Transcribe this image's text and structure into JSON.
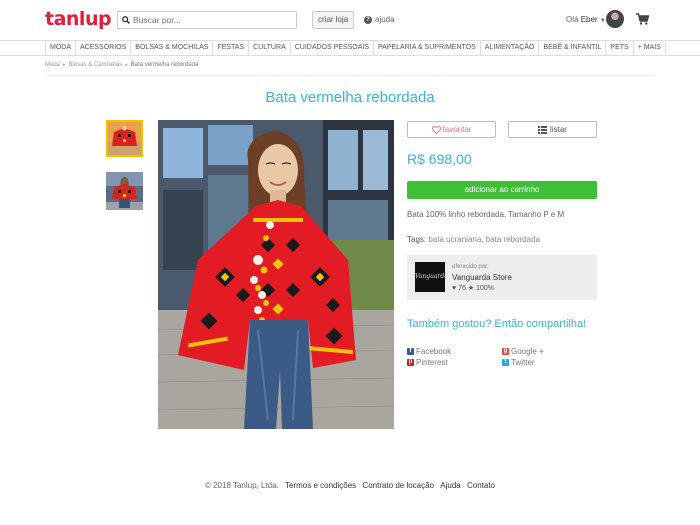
{
  "header": {
    "logo": "tanlup",
    "search_placeholder": "Buscar por...",
    "create_store": "criar loja",
    "help": "ajuda",
    "greeting": "Olá",
    "user_name": "Eber",
    "icons": {
      "search": "search-icon",
      "help": "question-icon",
      "cart": "cart-icon"
    }
  },
  "categories": [
    "MODA",
    "ACESSÓRIOS",
    "BOLSAS & MOCHILAS",
    "FESTAS",
    "CULTURA",
    "CUIDADOS PESSOAIS",
    "PAPELARIA & SUPRIMENTOS",
    "ALIMENTAÇÃO",
    "BEBÊ & INFANTIL",
    "PETS",
    "+ MAIS"
  ],
  "breadcrumbs": [
    "Moda",
    "Blusas & Camisetas",
    "Bata vermelha rebordada"
  ],
  "product": {
    "title": "Bata vermelha rebordada",
    "favorite_label": "favoritar",
    "list_label": "listar",
    "price": "R$ 698,00",
    "add_to_cart": "adicionar ao carrinho",
    "description": "Bata 100% linho rebordada. Tamanho P e M",
    "tags_label": "Tags:",
    "tags": [
      "bata ucraniana",
      "bata rebordada"
    ]
  },
  "seller": {
    "offered_by": "oferecido por:",
    "name": "Vanguarda Store",
    "logo_text": "Vanguarda",
    "likes": "76",
    "rating": "100%"
  },
  "share": {
    "title": "Também gostou? Então compartilha!",
    "facebook": "Facebook",
    "google": "Google +",
    "pinterest": "Pinterest",
    "twitter": "Twitter"
  },
  "footer": {
    "copyright": "© 2018 Tanlup, Ltda.",
    "links": [
      "Termos e condições",
      "Contrato de locação",
      "Ajuda",
      "Contato"
    ]
  },
  "colors": {
    "brand": "#e0203b",
    "accent": "#38b4d8",
    "cta": "#3fbf36",
    "favorite": "#e8728c"
  }
}
